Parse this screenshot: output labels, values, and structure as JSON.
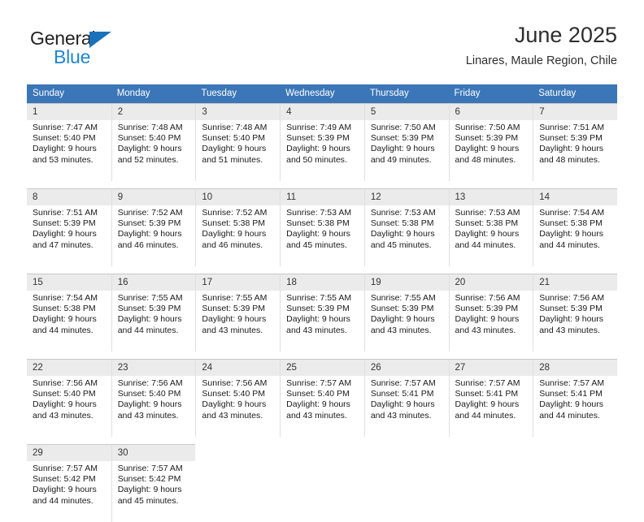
{
  "brand": {
    "name_top": "General",
    "name_bottom": "Blue",
    "accent_color": "#1b72bb",
    "blue_text_color": "#1b86d8"
  },
  "header": {
    "title": "June 2025",
    "subtitle": "Linares, Maule Region, Chile"
  },
  "calendar": {
    "header_bg": "#3a76b8",
    "daynum_bg": "#ebebeb",
    "weekday_headers": [
      "Sunday",
      "Monday",
      "Tuesday",
      "Wednesday",
      "Thursday",
      "Friday",
      "Saturday"
    ],
    "weeks": [
      {
        "days": [
          {
            "date": "1",
            "sunrise": "Sunrise: 7:47 AM",
            "sunset": "Sunset: 5:40 PM",
            "daylight_1": "Daylight: 9 hours",
            "daylight_2": "and 53 minutes."
          },
          {
            "date": "2",
            "sunrise": "Sunrise: 7:48 AM",
            "sunset": "Sunset: 5:40 PM",
            "daylight_1": "Daylight: 9 hours",
            "daylight_2": "and 52 minutes."
          },
          {
            "date": "3",
            "sunrise": "Sunrise: 7:48 AM",
            "sunset": "Sunset: 5:40 PM",
            "daylight_1": "Daylight: 9 hours",
            "daylight_2": "and 51 minutes."
          },
          {
            "date": "4",
            "sunrise": "Sunrise: 7:49 AM",
            "sunset": "Sunset: 5:39 PM",
            "daylight_1": "Daylight: 9 hours",
            "daylight_2": "and 50 minutes."
          },
          {
            "date": "5",
            "sunrise": "Sunrise: 7:50 AM",
            "sunset": "Sunset: 5:39 PM",
            "daylight_1": "Daylight: 9 hours",
            "daylight_2": "and 49 minutes."
          },
          {
            "date": "6",
            "sunrise": "Sunrise: 7:50 AM",
            "sunset": "Sunset: 5:39 PM",
            "daylight_1": "Daylight: 9 hours",
            "daylight_2": "and 48 minutes."
          },
          {
            "date": "7",
            "sunrise": "Sunrise: 7:51 AM",
            "sunset": "Sunset: 5:39 PM",
            "daylight_1": "Daylight: 9 hours",
            "daylight_2": "and 48 minutes."
          }
        ]
      },
      {
        "days": [
          {
            "date": "8",
            "sunrise": "Sunrise: 7:51 AM",
            "sunset": "Sunset: 5:39 PM",
            "daylight_1": "Daylight: 9 hours",
            "daylight_2": "and 47 minutes."
          },
          {
            "date": "9",
            "sunrise": "Sunrise: 7:52 AM",
            "sunset": "Sunset: 5:39 PM",
            "daylight_1": "Daylight: 9 hours",
            "daylight_2": "and 46 minutes."
          },
          {
            "date": "10",
            "sunrise": "Sunrise: 7:52 AM",
            "sunset": "Sunset: 5:38 PM",
            "daylight_1": "Daylight: 9 hours",
            "daylight_2": "and 46 minutes."
          },
          {
            "date": "11",
            "sunrise": "Sunrise: 7:53 AM",
            "sunset": "Sunset: 5:38 PM",
            "daylight_1": "Daylight: 9 hours",
            "daylight_2": "and 45 minutes."
          },
          {
            "date": "12",
            "sunrise": "Sunrise: 7:53 AM",
            "sunset": "Sunset: 5:38 PM",
            "daylight_1": "Daylight: 9 hours",
            "daylight_2": "and 45 minutes."
          },
          {
            "date": "13",
            "sunrise": "Sunrise: 7:53 AM",
            "sunset": "Sunset: 5:38 PM",
            "daylight_1": "Daylight: 9 hours",
            "daylight_2": "and 44 minutes."
          },
          {
            "date": "14",
            "sunrise": "Sunrise: 7:54 AM",
            "sunset": "Sunset: 5:38 PM",
            "daylight_1": "Daylight: 9 hours",
            "daylight_2": "and 44 minutes."
          }
        ]
      },
      {
        "days": [
          {
            "date": "15",
            "sunrise": "Sunrise: 7:54 AM",
            "sunset": "Sunset: 5:38 PM",
            "daylight_1": "Daylight: 9 hours",
            "daylight_2": "and 44 minutes."
          },
          {
            "date": "16",
            "sunrise": "Sunrise: 7:55 AM",
            "sunset": "Sunset: 5:39 PM",
            "daylight_1": "Daylight: 9 hours",
            "daylight_2": "and 44 minutes."
          },
          {
            "date": "17",
            "sunrise": "Sunrise: 7:55 AM",
            "sunset": "Sunset: 5:39 PM",
            "daylight_1": "Daylight: 9 hours",
            "daylight_2": "and 43 minutes."
          },
          {
            "date": "18",
            "sunrise": "Sunrise: 7:55 AM",
            "sunset": "Sunset: 5:39 PM",
            "daylight_1": "Daylight: 9 hours",
            "daylight_2": "and 43 minutes."
          },
          {
            "date": "19",
            "sunrise": "Sunrise: 7:55 AM",
            "sunset": "Sunset: 5:39 PM",
            "daylight_1": "Daylight: 9 hours",
            "daylight_2": "and 43 minutes."
          },
          {
            "date": "20",
            "sunrise": "Sunrise: 7:56 AM",
            "sunset": "Sunset: 5:39 PM",
            "daylight_1": "Daylight: 9 hours",
            "daylight_2": "and 43 minutes."
          },
          {
            "date": "21",
            "sunrise": "Sunrise: 7:56 AM",
            "sunset": "Sunset: 5:39 PM",
            "daylight_1": "Daylight: 9 hours",
            "daylight_2": "and 43 minutes."
          }
        ]
      },
      {
        "days": [
          {
            "date": "22",
            "sunrise": "Sunrise: 7:56 AM",
            "sunset": "Sunset: 5:40 PM",
            "daylight_1": "Daylight: 9 hours",
            "daylight_2": "and 43 minutes."
          },
          {
            "date": "23",
            "sunrise": "Sunrise: 7:56 AM",
            "sunset": "Sunset: 5:40 PM",
            "daylight_1": "Daylight: 9 hours",
            "daylight_2": "and 43 minutes."
          },
          {
            "date": "24",
            "sunrise": "Sunrise: 7:56 AM",
            "sunset": "Sunset: 5:40 PM",
            "daylight_1": "Daylight: 9 hours",
            "daylight_2": "and 43 minutes."
          },
          {
            "date": "25",
            "sunrise": "Sunrise: 7:57 AM",
            "sunset": "Sunset: 5:40 PM",
            "daylight_1": "Daylight: 9 hours",
            "daylight_2": "and 43 minutes."
          },
          {
            "date": "26",
            "sunrise": "Sunrise: 7:57 AM",
            "sunset": "Sunset: 5:41 PM",
            "daylight_1": "Daylight: 9 hours",
            "daylight_2": "and 43 minutes."
          },
          {
            "date": "27",
            "sunrise": "Sunrise: 7:57 AM",
            "sunset": "Sunset: 5:41 PM",
            "daylight_1": "Daylight: 9 hours",
            "daylight_2": "and 44 minutes."
          },
          {
            "date": "28",
            "sunrise": "Sunrise: 7:57 AM",
            "sunset": "Sunset: 5:41 PM",
            "daylight_1": "Daylight: 9 hours",
            "daylight_2": "and 44 minutes."
          }
        ]
      },
      {
        "days": [
          {
            "date": "29",
            "sunrise": "Sunrise: 7:57 AM",
            "sunset": "Sunset: 5:42 PM",
            "daylight_1": "Daylight: 9 hours",
            "daylight_2": "and 44 minutes."
          },
          {
            "date": "30",
            "sunrise": "Sunrise: 7:57 AM",
            "sunset": "Sunset: 5:42 PM",
            "daylight_1": "Daylight: 9 hours",
            "daylight_2": "and 45 minutes."
          },
          {
            "date": "",
            "sunrise": "",
            "sunset": "",
            "daylight_1": "",
            "daylight_2": ""
          },
          {
            "date": "",
            "sunrise": "",
            "sunset": "",
            "daylight_1": "",
            "daylight_2": ""
          },
          {
            "date": "",
            "sunrise": "",
            "sunset": "",
            "daylight_1": "",
            "daylight_2": ""
          },
          {
            "date": "",
            "sunrise": "",
            "sunset": "",
            "daylight_1": "",
            "daylight_2": ""
          },
          {
            "date": "",
            "sunrise": "",
            "sunset": "",
            "daylight_1": "",
            "daylight_2": ""
          }
        ]
      }
    ]
  }
}
